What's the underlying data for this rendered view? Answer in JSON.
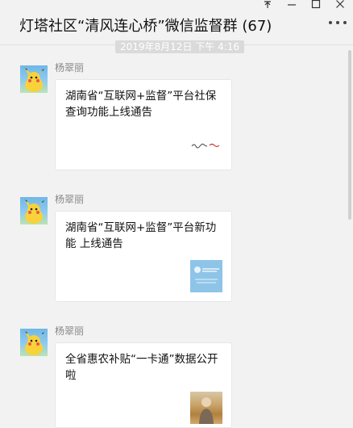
{
  "window": {
    "title": "灯塔社区“清风连心桥”微信监督群 (67)",
    "controls": [
      "pin-icon",
      "minimize-icon",
      "maximize-icon",
      "close-icon"
    ]
  },
  "chat": {
    "timestamp": "2019年8月12日 下午 4:16",
    "messages": [
      {
        "sender": "杨翠丽",
        "title": "湖南省“互联网+监督”平台社保查询功能上线通告",
        "thumbnail": "signature-thumbnail"
      },
      {
        "sender": "杨翠丽",
        "title": "湖南省“互联网+监督”平台新功能 上线通告",
        "thumbnail": "blue-card-thumbnail"
      },
      {
        "sender": "杨翠丽",
        "title": "全省惠农补贴“一卡通”数据公开啦",
        "thumbnail": "photo-thumbnail"
      }
    ]
  },
  "colors": {
    "background": "#f2f2f2",
    "card": "#ffffff",
    "sender": "#888888",
    "timestamp_bg": "#dadada"
  }
}
